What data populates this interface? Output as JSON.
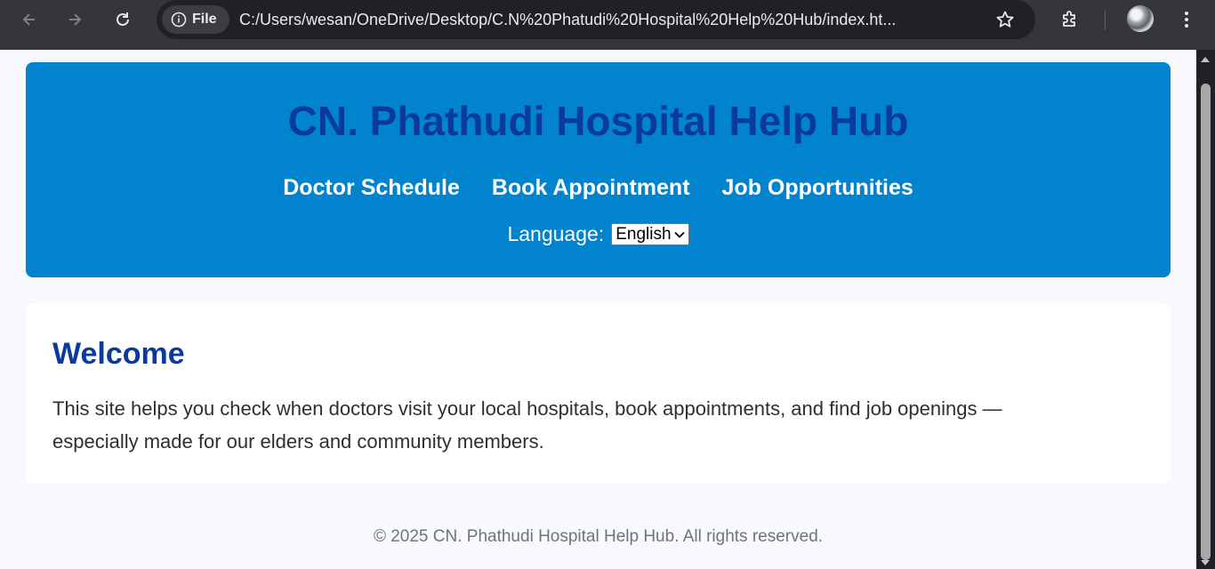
{
  "browser": {
    "chip_label": "File",
    "url": "C:/Users/wesan/OneDrive/Desktop/C.N%20Phatudi%20Hospital%20Help%20Hub/index.ht..."
  },
  "header": {
    "title": "CN. Phathudi Hospital Help Hub",
    "nav": [
      "Doctor Schedule",
      "Book Appointment",
      "Job Opportunities"
    ],
    "language_label": "Language:",
    "language_selected": "English"
  },
  "welcome": {
    "heading": "Welcome",
    "body": "This site helps you check when doctors visit your local hospitals, book appointments, and find job openings — especially made for our elders and community members."
  },
  "footer": {
    "text": "© 2025 CN. Phathudi Hospital Help Hub. All rights reserved."
  },
  "colors": {
    "header_bg": "#0283cd",
    "title": "#0a3b9c",
    "page_bg": "#f7f9fc"
  }
}
